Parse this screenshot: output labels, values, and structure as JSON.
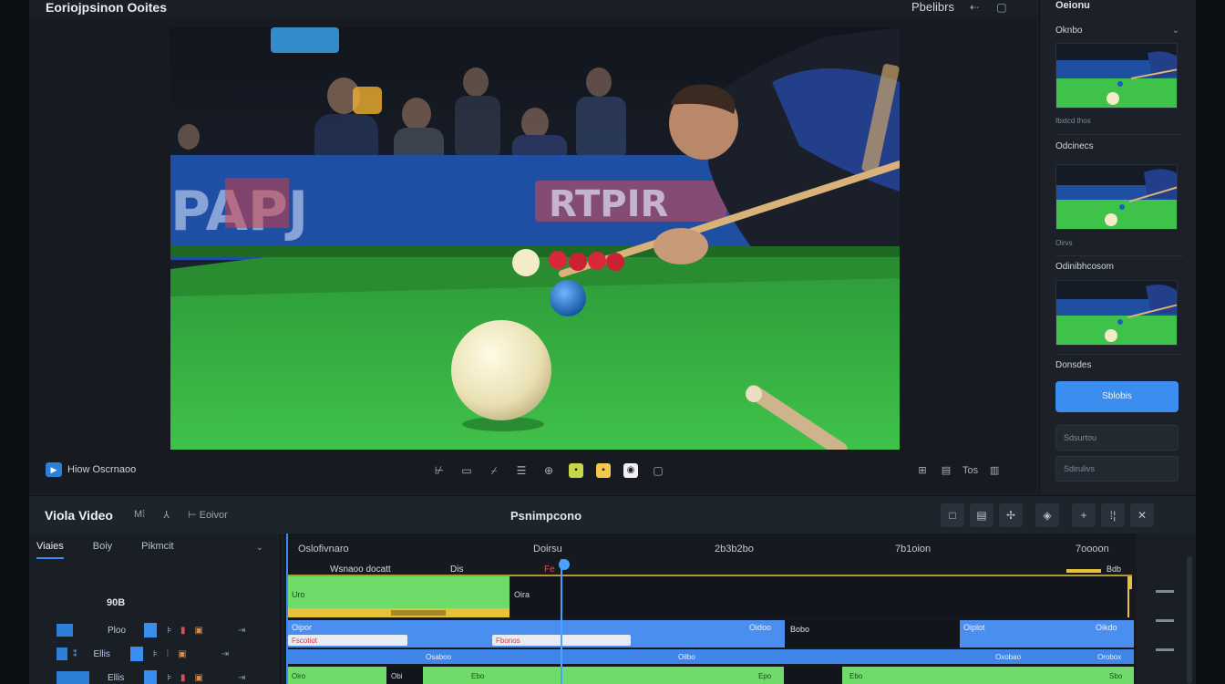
{
  "app": {
    "title": "Eoriojpsinon Ooites"
  },
  "topbar": {
    "right_label": "Pbelibrs",
    "icons": [
      "back-arrow-icon",
      "window-icon"
    ]
  },
  "preview": {
    "clip_badge": "▶",
    "clip_name": "Hiow Oscrnaoo",
    "scene": {
      "banner_left": "PAPJ",
      "banner_center": "RTPIR"
    }
  },
  "transport": {
    "icons": [
      "trim-icon",
      "crop-icon",
      "split-icon",
      "list-icon",
      "marker-icon",
      "color-green-icon",
      "color-yellow-icon",
      "color-white-icon",
      "box-icon"
    ]
  },
  "preview_right": {
    "items": [
      "⊞",
      "▤",
      "Tos",
      "▥"
    ]
  },
  "right_panel": {
    "title": "Oeionu",
    "sections": [
      {
        "label": "Oknbo",
        "caption": "Ibxtcd thos"
      },
      {
        "label": "Odcinecs",
        "caption": "Oirvs"
      },
      {
        "label": "Odinibhcosom",
        "caption": ""
      }
    ],
    "footer_label": "Donsdes",
    "primary_button": "Sblobis",
    "field_1": "Sdsurtou",
    "field_2": "Sdirulivs"
  },
  "timeline_bar": {
    "title": "Viola Video",
    "tools": [
      "M⁞",
      "⅄",
      "⊢ Eoivor"
    ],
    "center_title": "Psnimpcono",
    "right_buttons": [
      "□",
      "▤",
      "✢",
      "◈",
      "+",
      "⁞¦",
      "✕"
    ]
  },
  "tracks": {
    "tabs": [
      "Viaies",
      "Boiy",
      "Pikmcit"
    ],
    "active_tab": 0,
    "sub_label": "90B",
    "rows": [
      {
        "name": "Ploo"
      },
      {
        "name": "Ellis"
      },
      {
        "name": "Ellis"
      }
    ]
  },
  "timeline": {
    "ruler": [
      "Oslofivnaro",
      "Doirsu",
      "2b3b2bo",
      "7b1oion",
      "7oooon"
    ],
    "marker_labels": {
      "left": "Wsnaoo docatt",
      "mid": "Dis",
      "red": "Fe",
      "right": "Bdb"
    },
    "clip_labels": {
      "green_top": "Uro",
      "dark_top": "Oira",
      "blue_a": "Oipor",
      "blue_b": "Oidoo",
      "dark_mid": "Bobo",
      "blue_c": "Oiplot",
      "blue_d": "Oikdo",
      "field_a": "Fscotiot",
      "field_b": "Fbonos",
      "row2_labels": [
        "Osaboo",
        "Oilbo",
        "Oxobao",
        "Orobox"
      ],
      "row3_labels": [
        "Oiro",
        "Obi",
        "Ebo",
        "Epo",
        "Ebo",
        "Sbo"
      ]
    }
  },
  "colors": {
    "accent": "#3b8df0",
    "clip_green": "#6fdc6a",
    "clip_blue": "#4a8ff0",
    "playhead": "#4aa3ff",
    "marker_yellow": "#e5c23a"
  }
}
